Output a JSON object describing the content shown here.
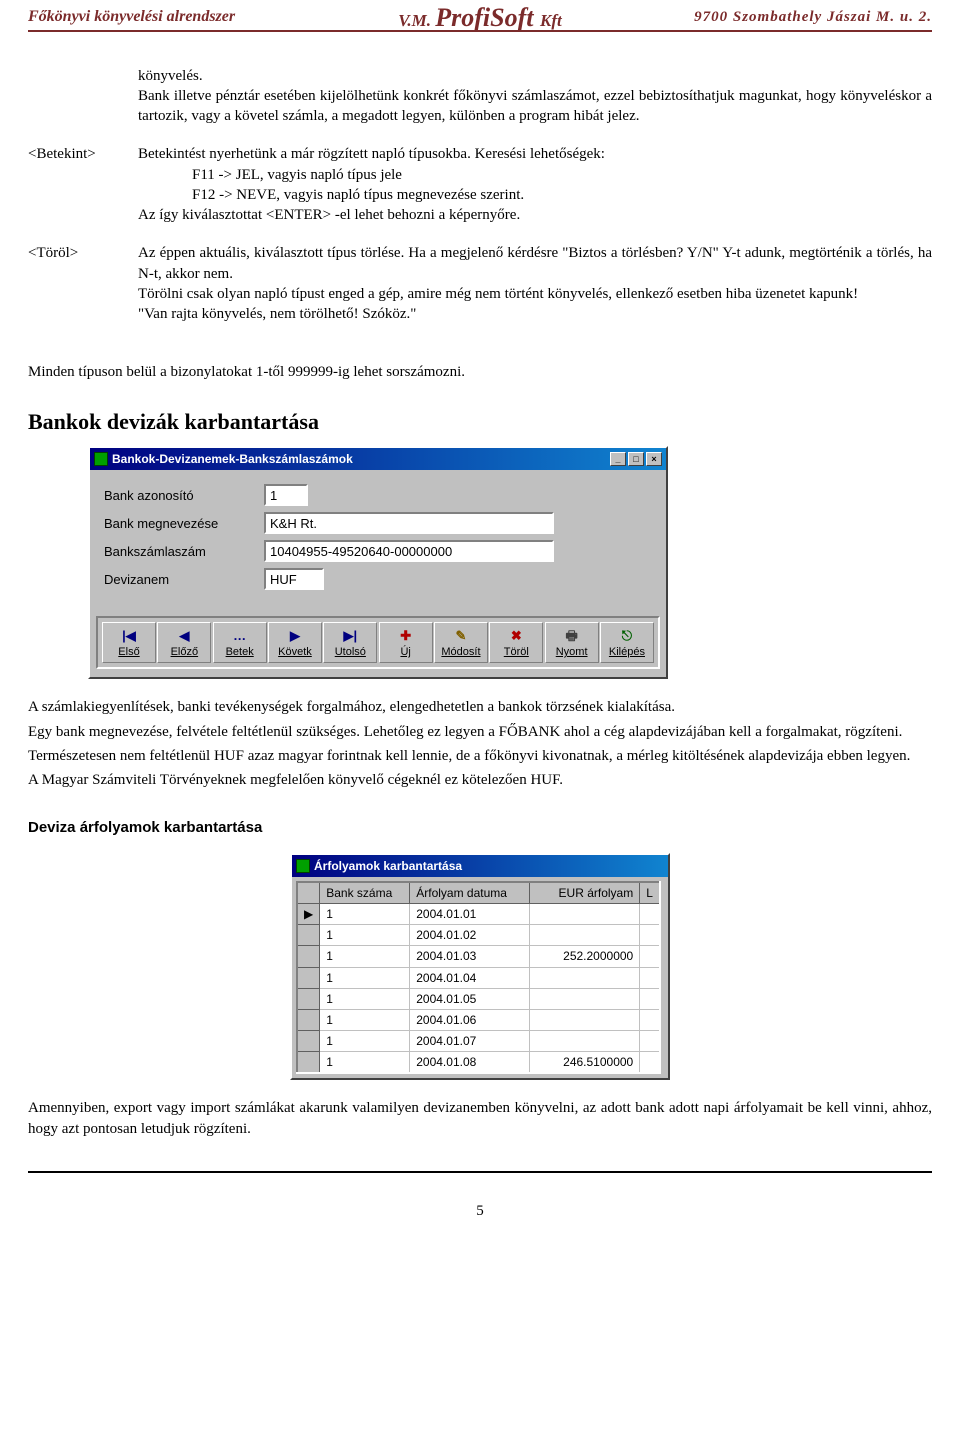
{
  "header": {
    "company_vm": "V.M. ",
    "company_profi": "ProfiSoft ",
    "company_kft": "Kft",
    "left": "Főkönyvi könyvelési alrendszer",
    "right": "9700 Szombathely  Jászai M. u. 2."
  },
  "intro": "könyvelés.",
  "intro_body": "Bank illetve pénztár esetében kijelölhetünk konkrét főkönyvi számlaszámot, ezzel bebiztosíthatjuk magunkat, hogy könyveléskor a tartozik, vagy a követel számla, a megadott legyen, különben a program hibát jelez.",
  "defs": [
    {
      "key": "<Betekint>",
      "text": "Betekintést nyerhetünk a már rögzített napló típusokba. Keresési lehetőségek:",
      "sub1": "F11 -> JEL, vagyis napló típus jele",
      "sub2": "F12 -> NEVE, vagyis napló típus megnevezése szerint.",
      "tail": "Az így kiválasztottat <ENTER> -el lehet behozni a képernyőre."
    },
    {
      "key": "<Töröl>",
      "text": "Az éppen aktuális, kiválasztott típus törlése. Ha a megjelenő kérdésre \"Biztos a törlésben? Y/N\" Y-t adunk, megtörténik a törlés, ha N-t, akkor nem.",
      "tail2a": "Törölni csak olyan napló típust enged a gép, amire még nem történt könyvelés, ellenkező esetben hiba üzenetet kapunk!",
      "tail2b": "\"Van rajta könyvelés, nem törölhető! Szóköz.\""
    }
  ],
  "sentence_sorszam": "Minden típuson belül a bizonylatokat 1-től 999999-ig lehet sorszámozni.",
  "h_bank": "Bankok devizák karbantartása",
  "bank_win": {
    "title": "Bankok-Devizanemek-Bankszámlaszámok",
    "labels": {
      "id": "Bank azonosító",
      "name": "Bank megnevezése",
      "acct": "Bankszámlaszám",
      "ccy": "Devizanem"
    },
    "values": {
      "id": "1",
      "name": "K&H Rt.",
      "acct": "10404955-49520640-00000000",
      "ccy": "HUF"
    },
    "buttons": [
      "Első",
      "Előző",
      "Betek",
      "Követk",
      "Utolsó",
      "Új",
      "Módosít",
      "Töröl",
      "Nyomt",
      "Kilépés"
    ],
    "icons": [
      "|◀",
      "◀",
      "…",
      "▶",
      "▶|",
      "✚",
      "✎",
      "✖",
      "🖶",
      "⎋"
    ]
  },
  "bank_para": [
    "A számlakiegyenlítések, banki tevékenységek forgalmához, elengedhetetlen a bankok törzsének kialakítása.",
    "Egy bank megnevezése, felvétele feltétlenül szükséges. Lehetőleg ez legyen a FŐBANK ahol a cég alapdevizájában kell a forgalmakat, rögzíteni.",
    "Természetesen nem feltétlenül HUF azaz magyar forintnak kell lennie, de a főkönyvi kivonatnak, a mérleg kitöltésének alapdevizája ebben legyen.",
    "A Magyar Számviteli Törvényeknek megfelelően könyvelő cégeknél ez kötelezően HUF."
  ],
  "h_deviza": "Deviza árfolyamok karbantartása",
  "rates_win": {
    "title": "Árfolyamok karbantartása",
    "columns": [
      "Bank száma",
      "Árfolyam datuma",
      "EUR árfolyam",
      "L"
    ],
    "rows": [
      {
        "bank": "1",
        "date": "2004.01.01",
        "rate": ""
      },
      {
        "bank": "1",
        "date": "2004.01.02",
        "rate": ""
      },
      {
        "bank": "1",
        "date": "2004.01.03",
        "rate": "252.2000000"
      },
      {
        "bank": "1",
        "date": "2004.01.04",
        "rate": ""
      },
      {
        "bank": "1",
        "date": "2004.01.05",
        "rate": ""
      },
      {
        "bank": "1",
        "date": "2004.01.06",
        "rate": ""
      },
      {
        "bank": "1",
        "date": "2004.01.07",
        "rate": ""
      },
      {
        "bank": "1",
        "date": "2004.01.08",
        "rate": "246.5100000"
      }
    ]
  },
  "deviza_para": "Amennyiben, export vagy import számlákat akarunk valamilyen devizanemben könyvelni, az adott bank adott napi árfolyamait be kell vinni, ahhoz, hogy azt pontosan letudjuk rögzíteni.",
  "page_number": "5"
}
